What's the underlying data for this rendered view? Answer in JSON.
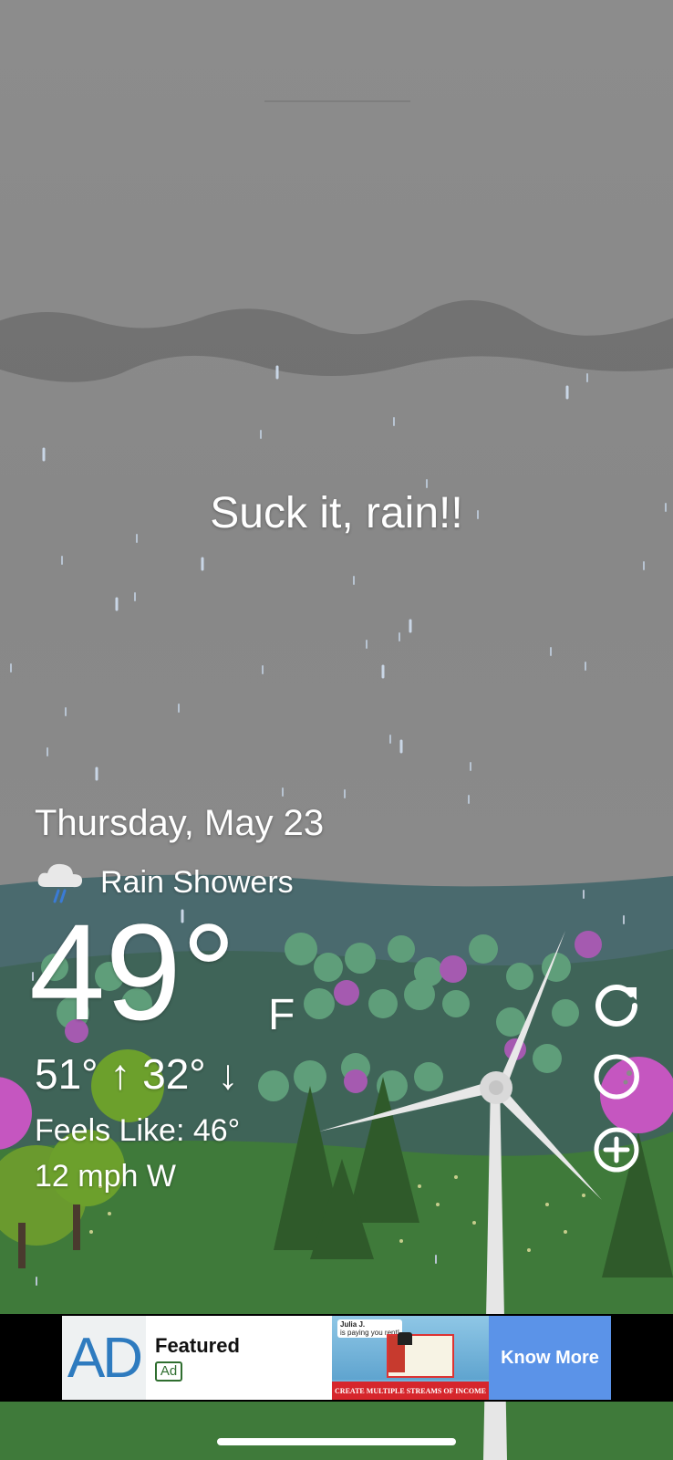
{
  "tagline": "Suck it, rain!!",
  "weather": {
    "date": "Thursday, May 23",
    "condition": "Rain Showers",
    "condition_icon": "rain-cloud-icon",
    "temperature": "49°",
    "unit": "F",
    "hi_lo": "51° ↑  32° ↓",
    "feels_like": "Feels Like: 46°",
    "wind": "12 mph W"
  },
  "side_buttons": {
    "refresh_icon": "refresh-icon",
    "moon_icon": "moon-icon",
    "add_icon": "add-location-icon"
  },
  "ad": {
    "logo_text": "AD",
    "title": "Featured",
    "tag": "Ad",
    "image_caption": "CREATE MULTIPLE STREAMS OF INCOME",
    "image_user": "Julia J.",
    "image_subtext": "is paying you rent!",
    "cta": "Know More"
  },
  "colors": {
    "sky": "#8a8a8a",
    "hills": "#4a6a6e",
    "grass": "#3f7a3a",
    "ad_cta": "#5b93e8"
  }
}
